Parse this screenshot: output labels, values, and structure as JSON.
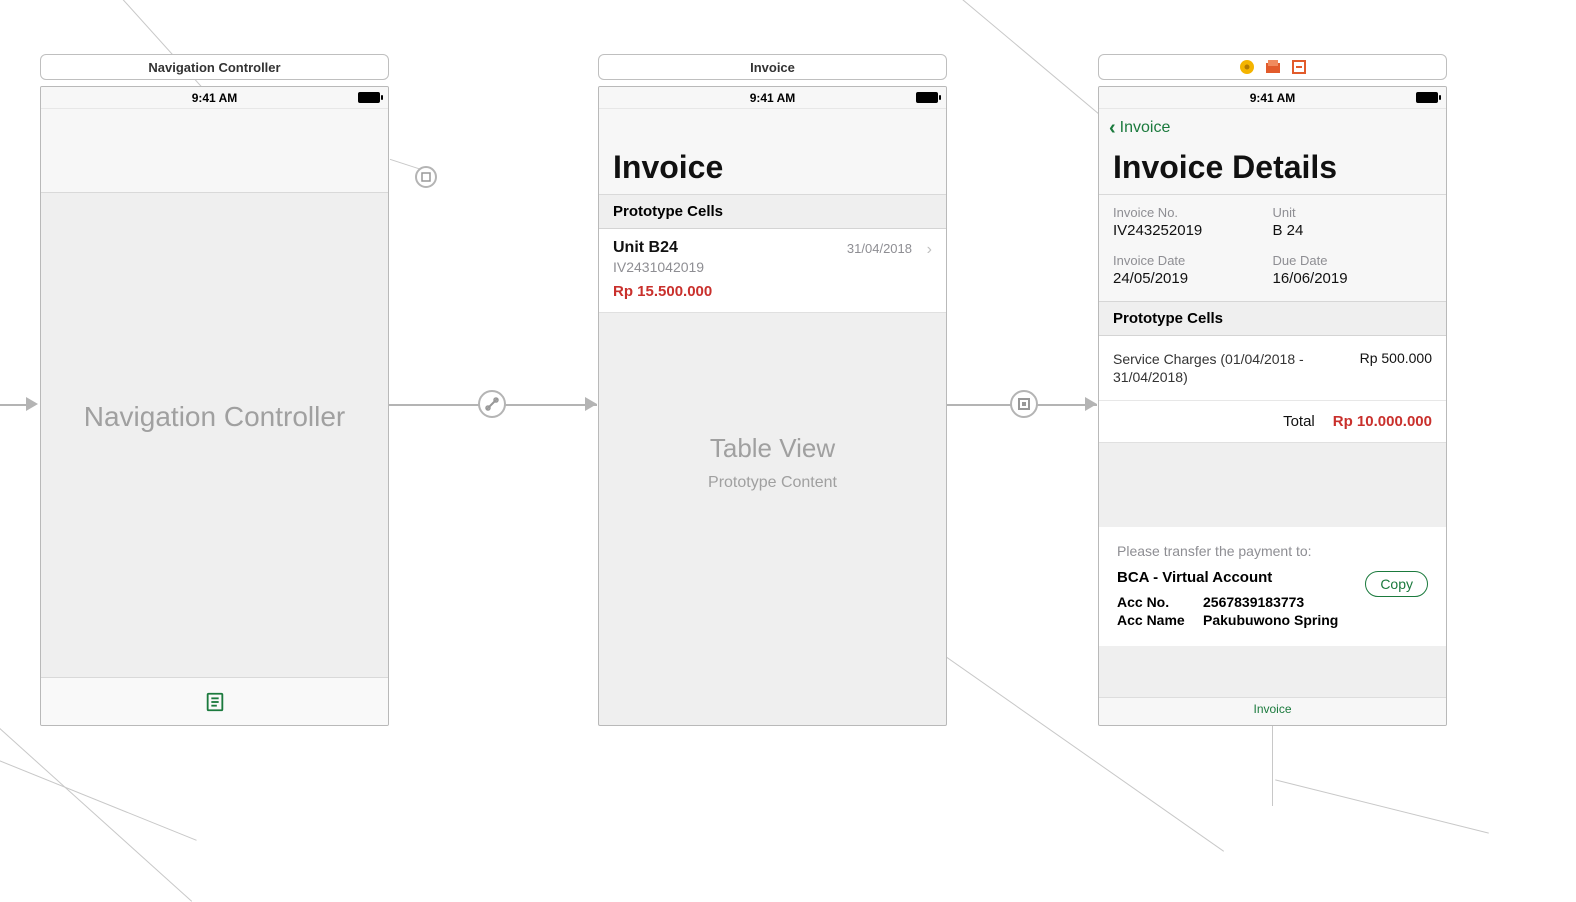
{
  "status_time": "9:41 AM",
  "scene1": {
    "label": "Navigation Controller",
    "placeholder": "Navigation Controller"
  },
  "scene2": {
    "label": "Invoice",
    "title": "Invoice",
    "proto_header": "Prototype Cells",
    "cell": {
      "unit": "Unit B24",
      "invoice_id": "IV2431042019",
      "amount": "Rp 15.500.000",
      "date": "31/04/2018"
    },
    "table_placeholder_title": "Table View",
    "table_placeholder_sub": "Prototype Content"
  },
  "scene3": {
    "back_label": "Invoice",
    "title": "Invoice Details",
    "fields": {
      "invoice_no_label": "Invoice No.",
      "invoice_no": "IV243252019",
      "unit_label": "Unit",
      "unit": "B 24",
      "invoice_date_label": "Invoice Date",
      "invoice_date": "24/05/2019",
      "due_date_label": "Due Date",
      "due_date": "16/06/2019"
    },
    "proto_header": "Prototype Cells",
    "charge_desc": "Service Charges (01/04/2018 - 31/04/2018)",
    "charge_amt": "Rp 500.000",
    "total_label": "Total",
    "total_amt": "Rp 10.000.000",
    "pay_intro": "Please transfer the payment to:",
    "pay_acct_type": "BCA - Virtual Account",
    "acc_no_label": "Acc No.",
    "acc_no": "2567839183773",
    "acc_name_label": "Acc Name",
    "acc_name": "Pakubuwono Spring",
    "copy_label": "Copy",
    "tab_label": "Invoice"
  }
}
